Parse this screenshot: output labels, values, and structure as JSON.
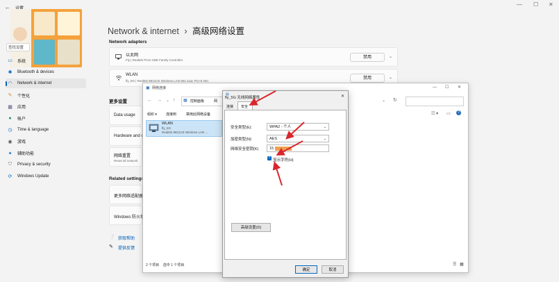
{
  "settings": {
    "title": "设置",
    "search_placeholder": "查找设置",
    "breadcrumb": {
      "parent": "Network & internet",
      "separator": "›",
      "current": "高级网络设置"
    },
    "sidebar": [
      {
        "label": "系统",
        "icon": "monitor-icon"
      },
      {
        "label": "Bluetooth & devices",
        "icon": "bluetooth-icon"
      },
      {
        "label": "Network & internet",
        "icon": "wifi-icon"
      },
      {
        "label": "个性化",
        "icon": "brush-icon"
      },
      {
        "label": "应用",
        "icon": "apps-icon"
      },
      {
        "label": "帐户",
        "icon": "person-icon"
      },
      {
        "label": "Time & language",
        "icon": "clock-icon"
      },
      {
        "label": "游戏",
        "icon": "gamepad-icon"
      },
      {
        "label": "辅助功能",
        "icon": "accessibility-icon"
      },
      {
        "label": "Privacy & security",
        "icon": "shield-icon"
      },
      {
        "label": "Windows Update",
        "icon": "update-icon"
      }
    ],
    "network_adapters_heading": "Network adapters",
    "adapters": [
      {
        "name": "以太网",
        "desc": "Fly | Realtek PCIe GBE Family Controller",
        "button": "禁用"
      },
      {
        "name": "WLAN",
        "desc": "fly_5G | Realtek 8821CE Wireless LAN 802.11ac PCI-E NIC",
        "button": "禁用"
      }
    ],
    "more_settings_heading": "更多设置",
    "more_items": [
      "Data usage",
      "Hardware and c",
      "网络重置",
      "Reset all network"
    ],
    "related_heading": "Related settings",
    "related_items": [
      "更多网络适配器",
      "Windows 防火墙"
    ],
    "help_links": [
      "获取帮助",
      "提供反馈"
    ]
  },
  "netconn": {
    "title": "网络连接",
    "address_parts": [
      "控制面板",
      "网"
    ],
    "toolbar": [
      "组织 ▾",
      "连接到",
      "禁用此网络设备"
    ],
    "item_name": "WLAN",
    "item_ssid": "fly_5G",
    "item_desc": "Realtek 8821CE Wireless LAN ...",
    "status": "2 个项目    选中 1 个项目"
  },
  "dialog": {
    "title": "fly_5G 无线网络属性",
    "tabs": [
      "连接",
      "安全"
    ],
    "security_type_label": "安全类型(E):",
    "security_type_value": "WPA2 - 个人",
    "encryption_label": "加密类型(N):",
    "encryption_value": "AES",
    "key_label": "网络安全密钥(K)",
    "key_value": "15",
    "show_chars_label": "显示字符(H)",
    "show_chars_checked": true,
    "advanced_button": "高级设置(D)",
    "ok_button": "确定",
    "cancel_button": "取消"
  },
  "colors": {
    "accent": "#005fb8",
    "arrow": "#d9262c",
    "redaction": "#f0a050"
  }
}
